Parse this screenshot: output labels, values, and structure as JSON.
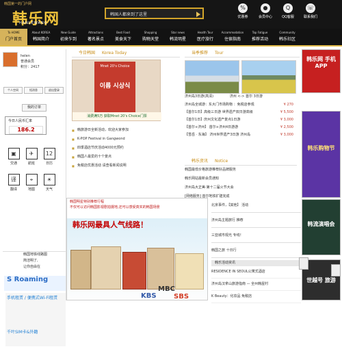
{
  "header": {
    "topline": "韩国第一的门户网",
    "logo": "韩乐网",
    "logo_en": "HANLEWANG",
    "search_placeholder": "韩国人都来到了这里",
    "icons": [
      {
        "name": "优惠券",
        "glyph": "%"
      },
      {
        "name": "会员中心",
        "glyph": "●"
      },
      {
        "name": "QQ客服",
        "glyph": "Q"
      },
      {
        "name": "联系我们",
        "glyph": "☏"
      }
    ]
  },
  "nav": [
    {
      "en": "To HOME",
      "zh": "门户首页"
    },
    {
      "en": "About KOREA",
      "zh": "韩国简介"
    },
    {
      "en": "New Guide",
      "zh": "初来乍到"
    },
    {
      "en": "Attractions",
      "zh": "著名景点"
    },
    {
      "en": "Best Food",
      "zh": "美食天下"
    },
    {
      "en": "Shopping",
      "zh": "购物天堂"
    },
    {
      "en": "Star news",
      "zh": "韩流明星"
    },
    {
      "en": "Health Tour",
      "zh": "医疗旅行"
    },
    {
      "en": "Accommodation",
      "zh": "住宿指南"
    },
    {
      "en": "Top Fatigue",
      "zh": "推荐活动"
    },
    {
      "en": "Community",
      "zh": "韩乐社区"
    }
  ],
  "left": {
    "user": {
      "name": "helen",
      "level": "普通会员",
      "points": "积分：2417"
    },
    "buttons": [
      "个人空间",
      "短消息",
      "退出登录"
    ],
    "orders": "我的订单",
    "rate": {
      "title": "今日人民币汇率",
      "value": "186.2"
    },
    "tools": [
      {
        "label": "交通",
        "glyph": "▣"
      },
      {
        "label": "航班",
        "glyph": "✈"
      },
      {
        "label": "日历",
        "glyph": "12"
      },
      {
        "label": "翻译",
        "glyph": "译"
      },
      {
        "label": "地图",
        "glyph": "⌖"
      },
      {
        "label": "天气",
        "glyph": "☀"
      }
    ],
    "ad": {
      "heading": "韩国地铁线路图",
      "subs": [
        "简洁明了,",
        "让你自由在"
      ],
      "roaming": "S Roaming",
      "wifi": "手机租赁 / 便携式Wi-Fi租赁",
      "wifi2": "千叶SIM卡&外籍"
    }
  },
  "center": {
    "title": "今日韩国",
    "sub": "Korea Today",
    "poster": {
      "line1": "Mnet 20's Choice",
      "line2": "이름 시상식"
    },
    "caption": "消费满5万 获取Mnet 20's Choice门票",
    "news": [
      "韩旅游日全新活动，欢迎大家参加",
      "K-POP Festival in Gangwond",
      "四季酒店节庆活动4000元预约",
      "韩国人最爱的十个景点",
      "免税店优惠活动 请查看新闻说明"
    ]
  },
  "mid": {
    "title": "当季推荐",
    "sub": "Tour",
    "caption_left": "济州岛3日游(高清)",
    "caption_right": "济州 <-> 首尔 3日游",
    "items": [
      {
        "text": "济州岛全城游：东大门市场购物 ：免税店参观",
        "price": "¥ 270"
      },
      {
        "text": "【首尔1日】高级三日游 世界遗产双日游高级",
        "price": "¥ 5,500"
      },
      {
        "text": "【首尔1日】庆州文化遗产景点1日游",
        "price": "¥ 3,000"
      },
      {
        "text": "【首尔+济州】 首尔+济州4日游游",
        "price": "¥ 2,500"
      },
      {
        "text": "【雪岳 · 东海】 济州世界遗产3日游 济州岛",
        "price": "¥ 3,000"
      }
    ],
    "notice_title": "韩乐资讯",
    "notice_sub": "Notice",
    "notices": [
      "韩国最低价格旅游推荐好品牌服务",
      "韩乐网站最新会员通知",
      "济州岛大正美·第十二届火节大会",
      "[网络服务] 首尔地铁扩建完成"
    ]
  },
  "banner": {
    "top1": "韩国明星特别推荐行程",
    "top2": "不仅可以访问韩国影视剧拍摄地,还可以感受真实的韩国场景",
    "title": "韩乐网最具人气线路！",
    "kbs": "KBS",
    "mbc": "MBC",
    "sbs": "SBS"
  },
  "right": {
    "links": [
      "北京事件，【其他】 活动",
      "济州岛主题旅行 推荐",
      "三亚城市观光 专线！",
      "韩国之旅 十日行"
    ],
    "head": "韩乐活动资讯",
    "smalls": [
      "RESIDENCE IN SEOUL公寓式酒店",
      "济州岛汉拿山旅游指南 — 全州韩屋村",
      "K Beauty：化妆品 免税店"
    ]
  },
  "ads": [
    {
      "text": "韩乐网 手机APP"
    },
    {
      "text": "韩乐购物节"
    },
    {
      "text": "韩流演唱会"
    },
    {
      "text": "世越号 旅游"
    }
  ]
}
